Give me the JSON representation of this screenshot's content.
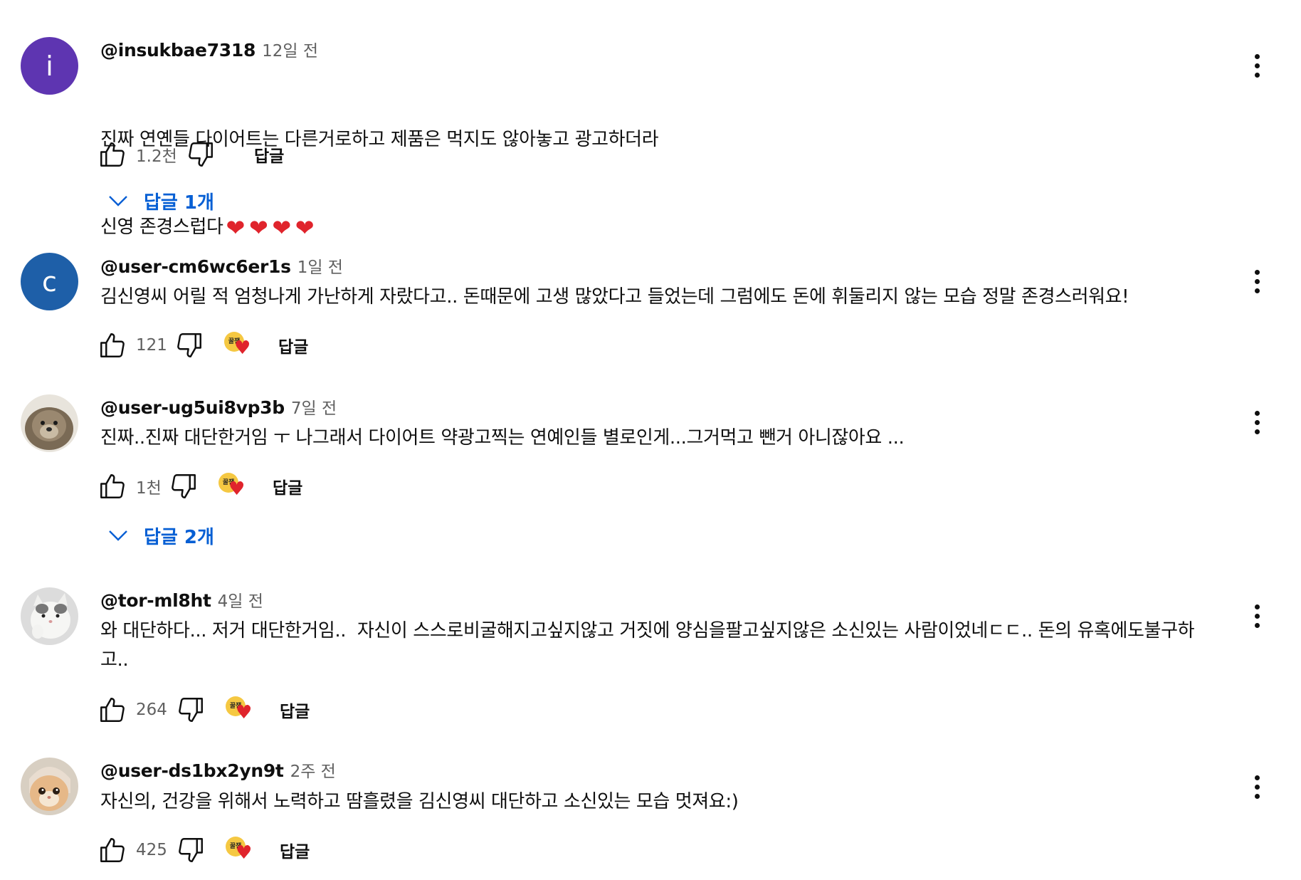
{
  "comments": [
    {
      "author": "@insukbae7318",
      "time": "12일 전",
      "text_line1": "진짜 연옌들 다이어트는 다른거로하고 제품은 먹지도 않아놓고 광고하더라",
      "text_line2": "신영 존경스럽다",
      "hearts": [
        "❤",
        "❤",
        "❤",
        "❤"
      ],
      "likes": "1.2천",
      "reply_label": "답글",
      "replies_toggle": "답글 1개",
      "avatar_letter": "i",
      "avatar_color": "#5e35b1"
    },
    {
      "author": "@user-cm6wc6er1s",
      "time": "1일 전",
      "text": "김신영씨 어릴 적 엄청나게 가난하게 자랐다고.. 돈때문에 고생 많았다고 들었는데 그럼에도 돈에 휘둘리지 않는 모습 정말 존경스러워요!",
      "likes": "121",
      "reply_label": "답글",
      "avatar_letter": "c",
      "avatar_color": "#1e5fa8"
    },
    {
      "author": "@user-ug5ui8vp3b",
      "time": "7일 전",
      "text": "진짜..진짜 대단한거임 ㅜ 나그래서 다이어트 약광고찍는 연예인들 별로인게...그거먹고 뺀거 아니잖아요 ...",
      "likes": "1천",
      "reply_label": "답글",
      "replies_toggle": "답글 2개"
    },
    {
      "author": "@tor-ml8ht",
      "time": "4일 전",
      "text": "와 대단하다... 저거 대단한거임..  자신이 스스로비굴해지고싶지않고 거짓에 양심을팔고싶지않은 소신있는 사람이었네ㄷㄷ.. 돈의 유혹에도불구하\n고..",
      "likes": "264",
      "reply_label": "답글"
    },
    {
      "author": "@user-ds1bx2yn9t",
      "time": "2주 전",
      "text": "자신의, 건강을 위해서 노력하고 땀흘렸을 김신영씨 대단하고 소신있는 모습 멋져요:)",
      "likes": "425",
      "reply_label": "답글"
    }
  ],
  "creator_badge_label": "꿀잼"
}
